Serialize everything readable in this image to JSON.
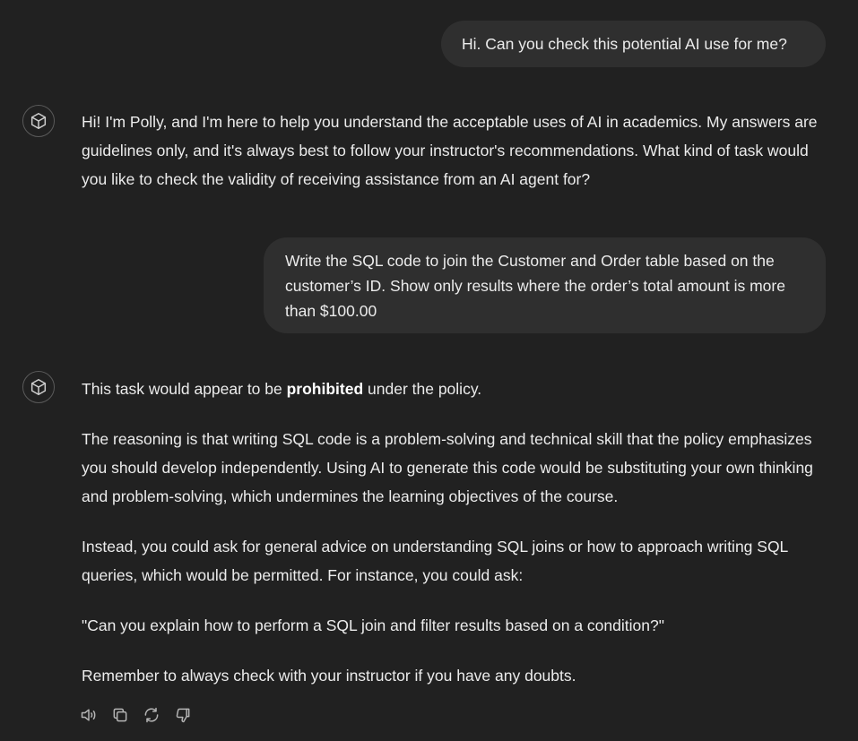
{
  "conversation": {
    "user_messages": [
      {
        "text": "Hi. Can you check this potential AI use for me?"
      },
      {
        "text": "Write the SQL code to join the Customer and Order table based on the customer’s ID. Show only results where the order’s total amount is more than $100.00"
      }
    ],
    "assistant_messages": [
      {
        "text": "Hi! I'm Polly, and I'm here to help you understand the acceptable uses of AI in academics. My answers are guidelines only, and it's always best to follow your instructor's recommendations. What kind of task would you like to check the validity of receiving assistance from an AI agent for?"
      },
      {
        "verdict_prefix": "This task would appear to be ",
        "verdict_bold": "prohibited",
        "verdict_suffix": " under the policy.",
        "reasoning": "The reasoning is that writing SQL code is a problem-solving and technical skill that the policy emphasizes you should develop independently. Using AI to generate this code would be substituting your own thinking and problem-solving, which undermines the learning objectives of the course.",
        "alternative": "Instead, you could ask for general advice on understanding SQL joins or how to approach writing SQL queries, which would be permitted. For instance, you could ask:",
        "example_question": "\"Can you explain how to perform a SQL join and filter results based on a condition?\"",
        "reminder": "Remember to always check with your instructor if you have any doubts."
      }
    ]
  },
  "avatar_icon": "cube-icon",
  "actions": [
    {
      "icon": "speaker-icon"
    },
    {
      "icon": "copy-icon"
    },
    {
      "icon": "regenerate-icon"
    },
    {
      "icon": "thumbs-down-icon"
    }
  ],
  "colors": {
    "background": "#212121",
    "user_bubble": "#2f2f2f",
    "text": "#ececec",
    "icon": "#b4b4b4"
  }
}
